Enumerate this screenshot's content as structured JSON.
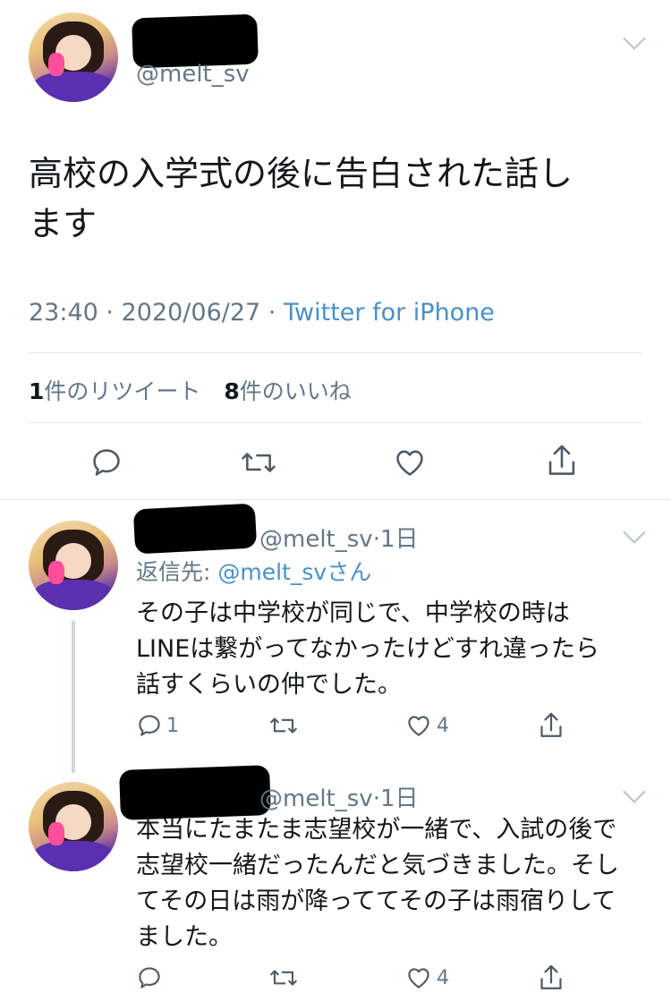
{
  "main_tweet": {
    "handle": "@melt_sv",
    "text_line1": "高校の入学式の後に告白された話し",
    "text_line2": "ます",
    "time": "23:40",
    "date": "2020/06/27",
    "source": "Twitter for iPhone",
    "retweet_count": "1",
    "retweet_label": "件のリツイート",
    "like_count": "8",
    "like_label": "件のいいね",
    "sep": "·"
  },
  "replies": [
    {
      "handle": "@melt_sv",
      "age": "1日",
      "reply_to_prefix": "返信先:",
      "reply_to_handle": "@melt_svさん",
      "lines": [
        "その子は中学校が同じで、中学校の時は",
        "LINEは繋がってなかったけどすれ違ったら",
        "話すくらいの仲でした。"
      ],
      "reply_count": "1",
      "like_count": "4"
    },
    {
      "handle": "@melt_sv",
      "age": "1日",
      "lines": [
        "本当にたまたま志望校が一緒で、入試の後で",
        "志望校一緒だったんだと気づきました。そし",
        "てその日は雨が降っててその子は雨宿りして",
        "ました。"
      ],
      "like_count": "4"
    }
  ],
  "icons": [
    "reply-icon",
    "retweet-icon",
    "like-icon",
    "share-icon",
    "chevron-down-icon"
  ],
  "colors": {
    "link": "#4a90c8",
    "muted": "#657786",
    "divider": "#e1e8ed"
  }
}
